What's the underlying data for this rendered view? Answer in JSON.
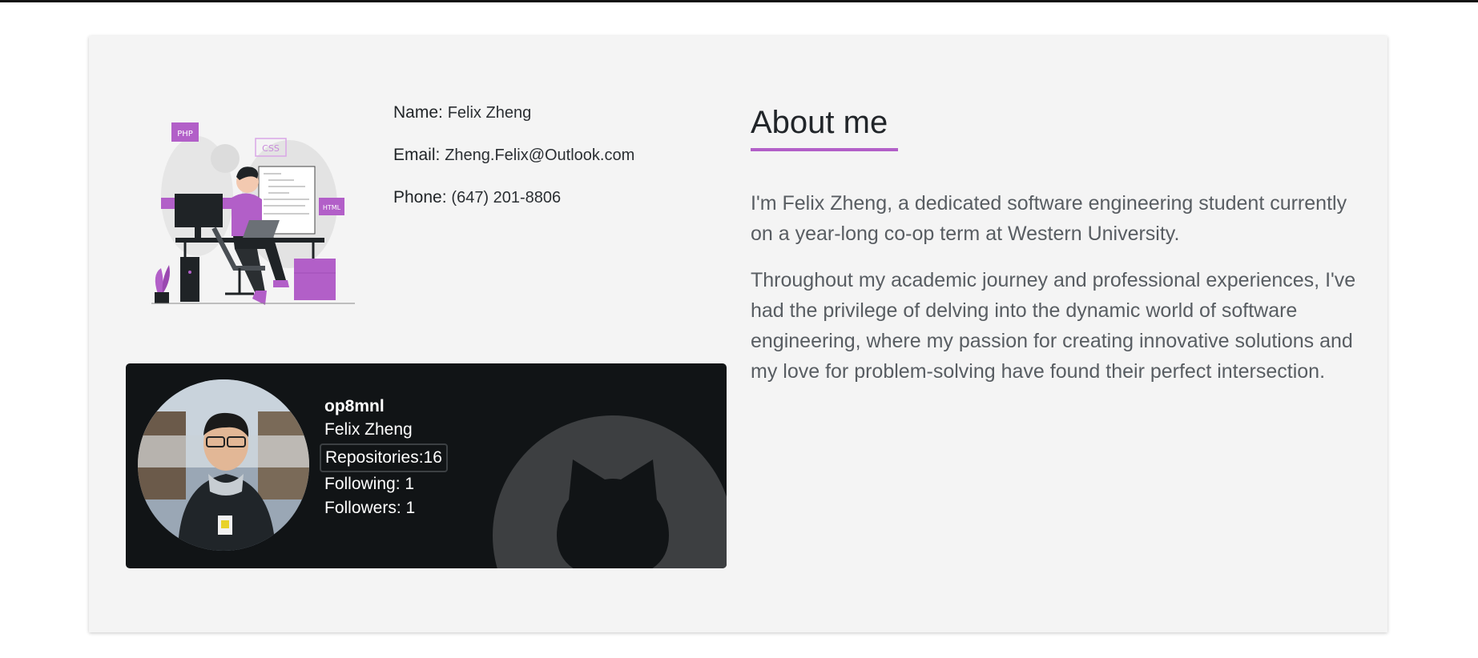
{
  "contact": {
    "name_label": "Name:",
    "name_value": "Felix Zheng",
    "email_label": "Email:",
    "email_value": "Zheng.Felix@Outlook.com",
    "phone_label": "Phone:",
    "phone_value": "(647) 201-8806"
  },
  "illustration": {
    "tags": [
      "PHP",
      "CSS",
      "HTML"
    ],
    "icon": "developer-at-desk-illustration"
  },
  "about": {
    "title": "About me",
    "paragraphs": [
      "I'm Felix Zheng, a dedicated software engineering student currently on a year-long co-op term at Western University.",
      "Throughout my academic journey and professional experiences, I've had the privilege of delving into the dynamic world of software engineering, where my passion for creating innovative solutions and my love for problem-solving have found their perfect intersection."
    ]
  },
  "github": {
    "username": "op8mnl",
    "name": "Felix Zheng",
    "repositories": "Repositories:16",
    "following": "Following: 1",
    "followers": "Followers: 1",
    "background_icon": "github-octocat-icon"
  },
  "colors": {
    "accent": "#b25fc8",
    "card_bg": "#f4f4f4",
    "github_card_bg": "#111416"
  }
}
